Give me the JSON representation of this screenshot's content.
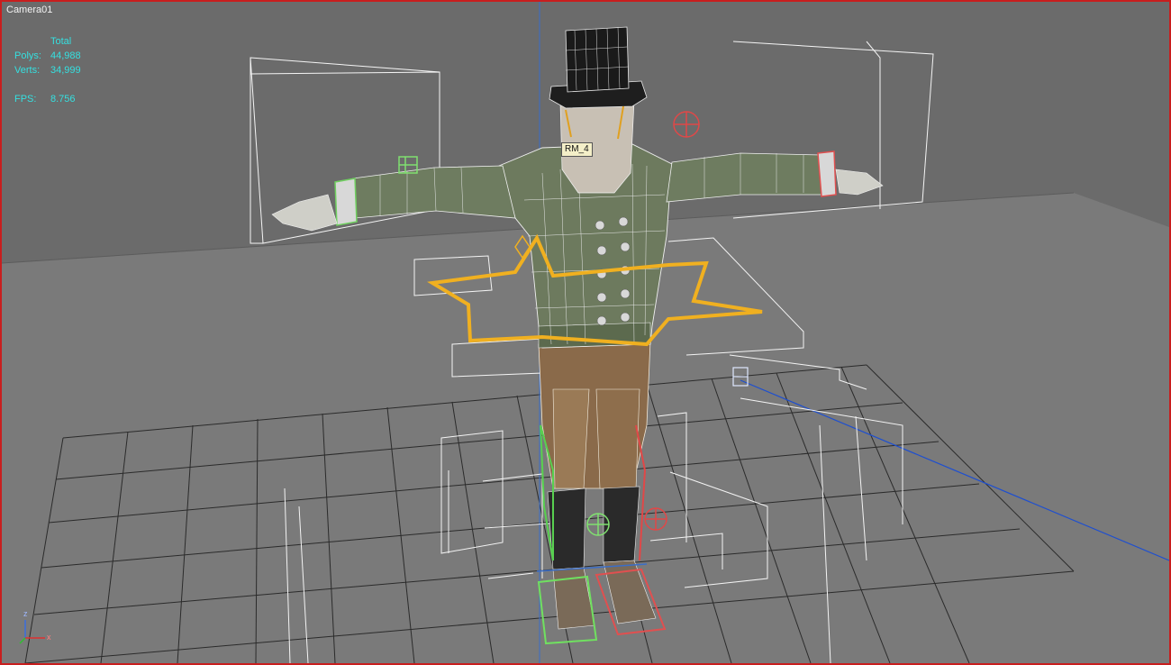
{
  "viewport": {
    "label": "Camera01",
    "colors": {
      "background": "#6b6b6b",
      "border": "#c81e1e",
      "stats_text": "#35e0e0",
      "selection": "#f0b020"
    }
  },
  "stats": {
    "header": "Total",
    "polys_label": "Polys:",
    "polys_value": "44,988",
    "verts_label": "Verts:",
    "verts_value": "34,999",
    "fps_label": "FPS:",
    "fps_value": "8.756"
  },
  "selected_bone": {
    "label": "RM_4"
  },
  "axis_gizmo": {
    "x_label": "x",
    "z_label": "z"
  }
}
